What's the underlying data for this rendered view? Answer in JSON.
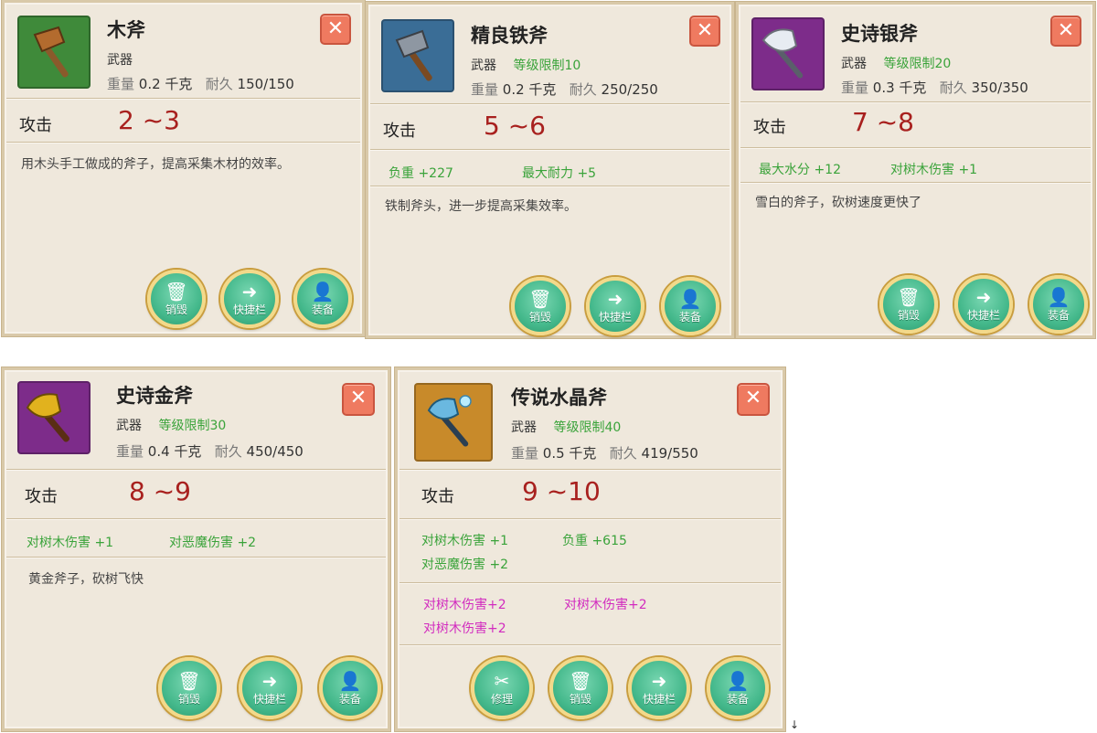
{
  "common": {
    "weight_label": "重量",
    "durability_label": "耐久",
    "attack_label": "攻击",
    "close_glyph": "✕",
    "btn_destroy": "销毁",
    "btn_shortcut": "快捷栏",
    "btn_equip": "装备",
    "btn_repair": "修理"
  },
  "cards": [
    {
      "name": "木斧",
      "type": "武器",
      "level": "",
      "weight": "0.2 千克",
      "durability": "150/150",
      "attack": "2 ~3",
      "attrs": [],
      "desc": "用木头手工做成的斧子，提高采集木材的效率。",
      "icon_bg": "#3f8a3a",
      "icon": "wooden-axe-icon"
    },
    {
      "name": "精良铁斧",
      "type": "武器",
      "level": "等级限制10",
      "weight": "0.2 千克",
      "durability": "250/250",
      "attack": "5 ~6",
      "attrs": [
        "负重 +227",
        "最大耐力 +5"
      ],
      "desc": "铁制斧头，进一步提高采集效率。",
      "icon_bg": "#3a6d96",
      "icon": "iron-axe-icon"
    },
    {
      "name": "史诗银斧",
      "type": "武器",
      "level": "等级限制20",
      "weight": "0.3 千克",
      "durability": "350/350",
      "attack": "7 ~8",
      "attrs": [
        "最大水分 +12",
        "对树木伤害 +1"
      ],
      "desc": "雪白的斧子，砍树速度更快了",
      "icon_bg": "#7d2c8a",
      "icon": "silver-axe-icon"
    },
    {
      "name": "史诗金斧",
      "type": "武器",
      "level": "等级限制30",
      "weight": "0.4 千克",
      "durability": "450/450",
      "attack": "8 ~9",
      "attrs": [
        "对树木伤害 +1",
        "对恶魔伤害 +2"
      ],
      "desc": "黄金斧子，砍树飞快",
      "icon_bg": "#7d2c8a",
      "icon": "golden-axe-icon"
    },
    {
      "name": "传说水晶斧",
      "type": "武器",
      "level": "等级限制40",
      "weight": "0.5 千克",
      "durability": "419/550",
      "attack": "9 ~10",
      "attrs": [
        "对树木伤害 +1",
        "负重 +615",
        "对恶魔伤害 +2"
      ],
      "pink_attrs": [
        "对树木伤害+2",
        "对树木伤害+2",
        "对树木伤害+2"
      ],
      "icon_bg": "#c88a2a",
      "icon": "crystal-axe-icon"
    }
  ],
  "colors": {
    "panel_bg": "#efe8dc",
    "attack_value": "#a8201e",
    "level_green": "#3aa33a",
    "attr_pink": "#d22bbf",
    "close_red": "#ef7a60",
    "button_green": "#45b98c"
  }
}
